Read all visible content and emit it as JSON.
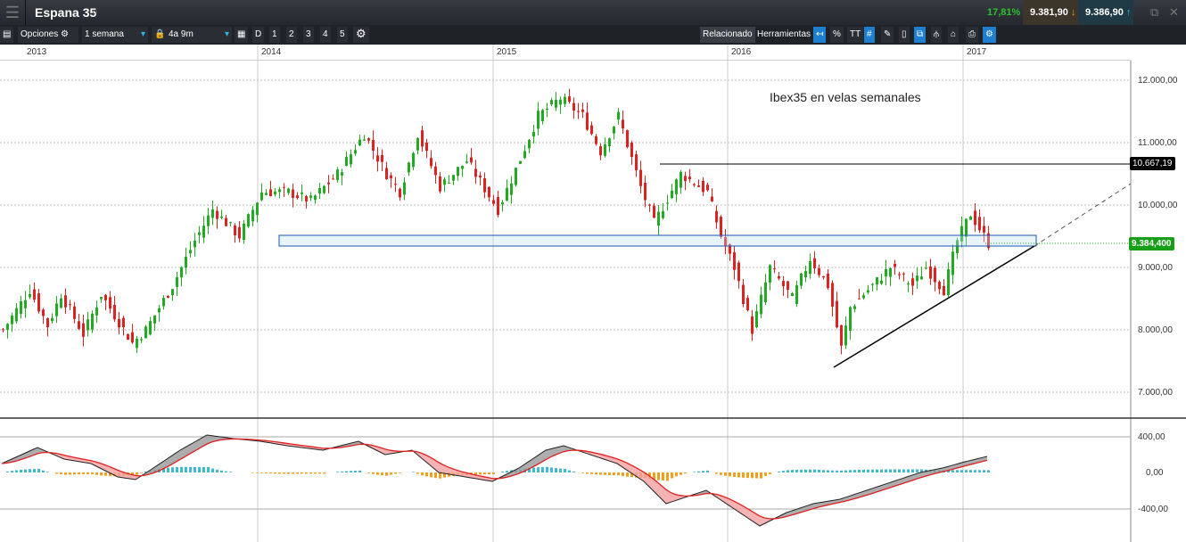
{
  "header": {
    "title": "Espana 35",
    "change": "17,81%",
    "bid": "9.381,90",
    "ask": "9.386,90"
  },
  "toolbar": {
    "options": "Opciones",
    "period": "1 semana",
    "range": "4a 9m",
    "d": "D",
    "n1": "1",
    "n2": "2",
    "n3": "3",
    "n4": "4",
    "n5": "5",
    "related": "Relacionado",
    "tools": "Herramientas",
    "pct": "%",
    "text": "TT"
  },
  "chart_data": {
    "type": "candlestick",
    "title": "Ibex35 en velas semanales",
    "x_ticks": [
      "2013",
      "2014",
      "2015",
      "2016",
      "2017"
    ],
    "y_ticks": [
      "12.000,00",
      "11.000,00",
      "10.000,00",
      "9.000,00",
      "8.000,00",
      "7.000,00"
    ],
    "ylim": [
      6600,
      12300
    ],
    "close_anchors": [
      [
        0,
        8000
      ],
      [
        6,
        8640
      ],
      [
        10,
        8070
      ],
      [
        13,
        8570
      ],
      [
        18,
        7930
      ],
      [
        22,
        8570
      ],
      [
        29,
        7790
      ],
      [
        32,
        8000
      ],
      [
        38,
        8710
      ],
      [
        43,
        9430
      ],
      [
        47,
        9930
      ],
      [
        53,
        9500
      ],
      [
        58,
        10210
      ],
      [
        64,
        10210
      ],
      [
        69,
        10070
      ],
      [
        75,
        10500
      ],
      [
        81,
        11140
      ],
      [
        86,
        10500
      ],
      [
        89,
        10210
      ],
      [
        93,
        11140
      ],
      [
        98,
        10290
      ],
      [
        104,
        10710
      ],
      [
        111,
        9930
      ],
      [
        115,
        10570
      ],
      [
        120,
        11430
      ],
      [
        125,
        11710
      ],
      [
        130,
        11430
      ],
      [
        134,
        10860
      ],
      [
        138,
        11430
      ],
      [
        143,
        10290
      ],
      [
        146,
        9710
      ],
      [
        152,
        10500
      ],
      [
        158,
        10210
      ],
      [
        161,
        9500
      ],
      [
        164,
        9000
      ],
      [
        168,
        8000
      ],
      [
        172,
        9000
      ],
      [
        177,
        8500
      ],
      [
        181,
        9140
      ],
      [
        185,
        8710
      ],
      [
        188,
        7710
      ],
      [
        190,
        8360
      ],
      [
        195,
        8710
      ],
      [
        199,
        9000
      ],
      [
        204,
        8710
      ],
      [
        207,
        9000
      ],
      [
        211,
        8640
      ],
      [
        214,
        9430
      ],
      [
        217,
        9860
      ],
      [
        221,
        9384
      ]
    ],
    "levels": {
      "resistance": "10.667,19",
      "current": "9.384,400"
    },
    "macd": {
      "y_ticks": [
        "400,00",
        "0,00",
        "-400,00"
      ],
      "ylim": [
        -700,
        500
      ],
      "anchors": [
        [
          0,
          100
        ],
        [
          8,
          280
        ],
        [
          14,
          150
        ],
        [
          20,
          100
        ],
        [
          26,
          -50
        ],
        [
          30,
          -80
        ],
        [
          34,
          50
        ],
        [
          40,
          250
        ],
        [
          46,
          420
        ],
        [
          52,
          380
        ],
        [
          58,
          350
        ],
        [
          64,
          300
        ],
        [
          72,
          250
        ],
        [
          80,
          350
        ],
        [
          86,
          200
        ],
        [
          92,
          250
        ],
        [
          98,
          0
        ],
        [
          104,
          -50
        ],
        [
          110,
          -100
        ],
        [
          116,
          50
        ],
        [
          122,
          250
        ],
        [
          126,
          300
        ],
        [
          132,
          200
        ],
        [
          138,
          100
        ],
        [
          144,
          -100
        ],
        [
          149,
          -350
        ],
        [
          158,
          -200
        ],
        [
          164,
          -400
        ],
        [
          170,
          -600
        ],
        [
          176,
          -450
        ],
        [
          182,
          -350
        ],
        [
          188,
          -300
        ],
        [
          194,
          -200
        ],
        [
          200,
          -100
        ],
        [
          206,
          0
        ],
        [
          211,
          50
        ],
        [
          216,
          120
        ],
        [
          221,
          180
        ]
      ]
    }
  }
}
